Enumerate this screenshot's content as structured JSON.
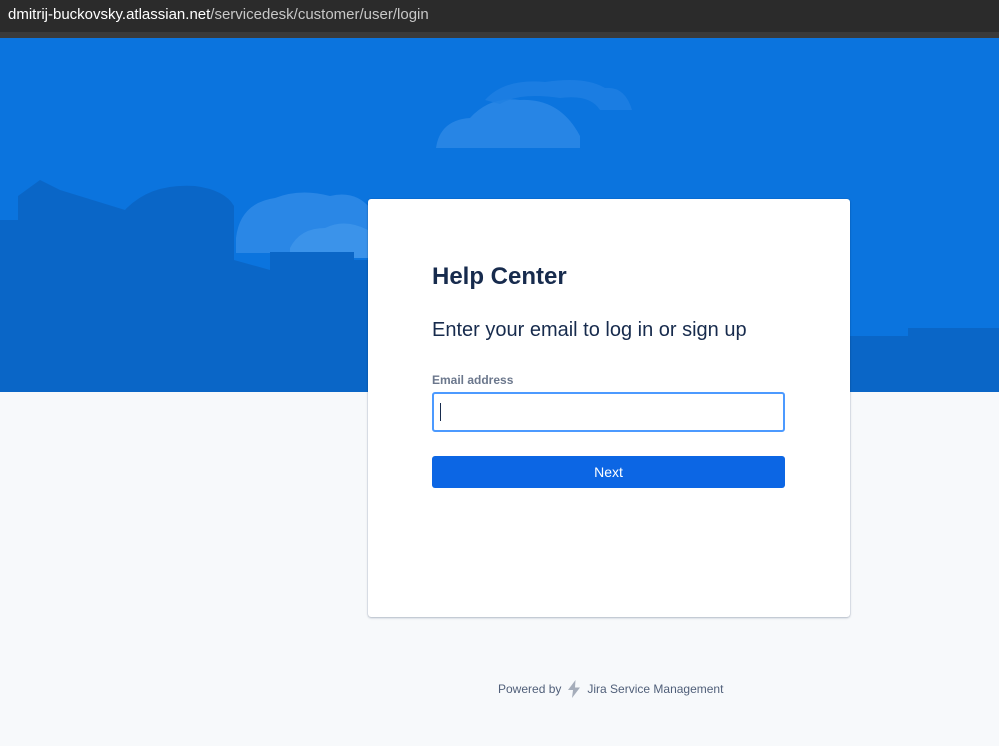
{
  "browser": {
    "url_host": "dmitrij-buckovsky.atlassian.net",
    "url_path": "/servicedesk/customer/user/login"
  },
  "login": {
    "title": "Help Center",
    "subtitle": "Enter your email to log in or sign up",
    "email_label": "Email address",
    "email_value": "",
    "next_label": "Next"
  },
  "footer": {
    "powered_by": "Powered by",
    "product": "Jira Service Management"
  },
  "icons": {
    "footer_logo": "jira-service-management-bolt-icon"
  },
  "colors": {
    "hero_blue": "#0b74de",
    "button_blue": "#0c66e4",
    "focus_border": "#4c9aff",
    "text_dark": "#172b4d",
    "background": "#f7f9fb"
  }
}
